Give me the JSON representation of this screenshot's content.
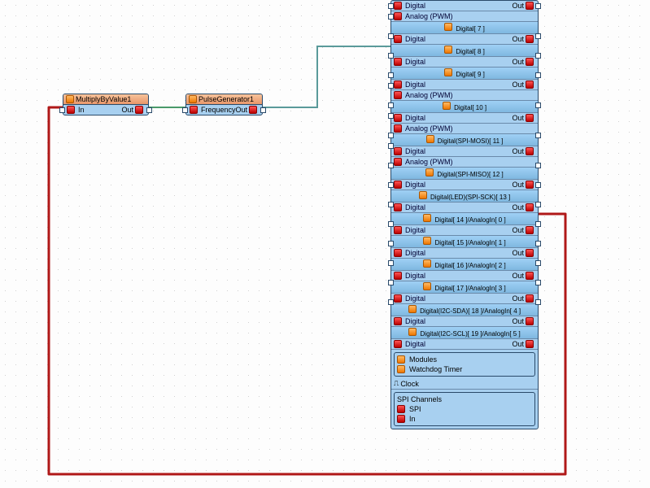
{
  "nodes": {
    "multiply": {
      "title": "MultiplyByValue1",
      "in": "In",
      "out": "Out"
    },
    "pulse": {
      "title": "PulseGenerator1",
      "in": "Frequency",
      "out": "Out"
    }
  },
  "device": {
    "pins": [
      {
        "headers": [],
        "rows": [
          {
            "l": "Digital",
            "r": "Out"
          },
          {
            "l": "Analog (PWM)",
            "r": ""
          }
        ]
      },
      {
        "headers": [
          "Digital[ 7 ]"
        ],
        "rows": [
          {
            "l": "Digital",
            "r": "Out"
          }
        ]
      },
      {
        "headers": [
          "Digital[ 8 ]"
        ],
        "rows": [
          {
            "l": "Digital",
            "r": "Out"
          }
        ]
      },
      {
        "headers": [
          "Digital[ 9 ]"
        ],
        "rows": [
          {
            "l": "Digital",
            "r": "Out"
          },
          {
            "l": "Analog (PWM)",
            "r": ""
          }
        ]
      },
      {
        "headers": [
          "Digital[ 10 ]"
        ],
        "rows": [
          {
            "l": "Digital",
            "r": "Out"
          },
          {
            "l": "Analog (PWM)",
            "r": ""
          }
        ]
      },
      {
        "headers": [
          "Digital(SPI-MOSI)[ 11 ]"
        ],
        "rows": [
          {
            "l": "Digital",
            "r": "Out"
          },
          {
            "l": "Analog (PWM)",
            "r": ""
          }
        ]
      },
      {
        "headers": [
          "Digital(SPI-MISO)[ 12 ]"
        ],
        "rows": [
          {
            "l": "Digital",
            "r": "Out"
          }
        ]
      },
      {
        "headers": [
          "Digital(LED)(SPI-SCK)[ 13 ]"
        ],
        "rows": [
          {
            "l": "Digital",
            "r": "Out"
          }
        ]
      },
      {
        "headers": [
          "Digital[ 14 ]/AnalogIn[ 0 ]"
        ],
        "rows": [
          {
            "l": "Digital",
            "r": "Out"
          }
        ]
      },
      {
        "headers": [
          "Digital[ 15 ]/AnalogIn[ 1 ]"
        ],
        "rows": [
          {
            "l": "Digital",
            "r": "Out"
          }
        ]
      },
      {
        "headers": [
          "Digital[ 16 ]/AnalogIn[ 2 ]"
        ],
        "rows": [
          {
            "l": "Digital",
            "r": "Out"
          }
        ]
      },
      {
        "headers": [
          "Digital[ 17 ]/AnalogIn[ 3 ]"
        ],
        "rows": [
          {
            "l": "Digital",
            "r": "Out"
          }
        ]
      },
      {
        "headers": [
          "Digital(I2C-SDA)[ 18 ]/AnalogIn[ 4 ]"
        ],
        "rows": [
          {
            "l": "Digital",
            "r": "Out"
          }
        ]
      },
      {
        "headers": [
          "Digital(I2C-SCL)[ 19 ]/AnalogIn[ 5 ]"
        ],
        "rows": [
          {
            "l": "Digital",
            "r": "Out"
          }
        ]
      }
    ],
    "modules": {
      "title": "Modules",
      "watchdog": "Watchdog Timer",
      "clock": "Clock"
    },
    "spi": {
      "title": "SPI Channels",
      "spi": "SPI",
      "in": "In"
    }
  }
}
